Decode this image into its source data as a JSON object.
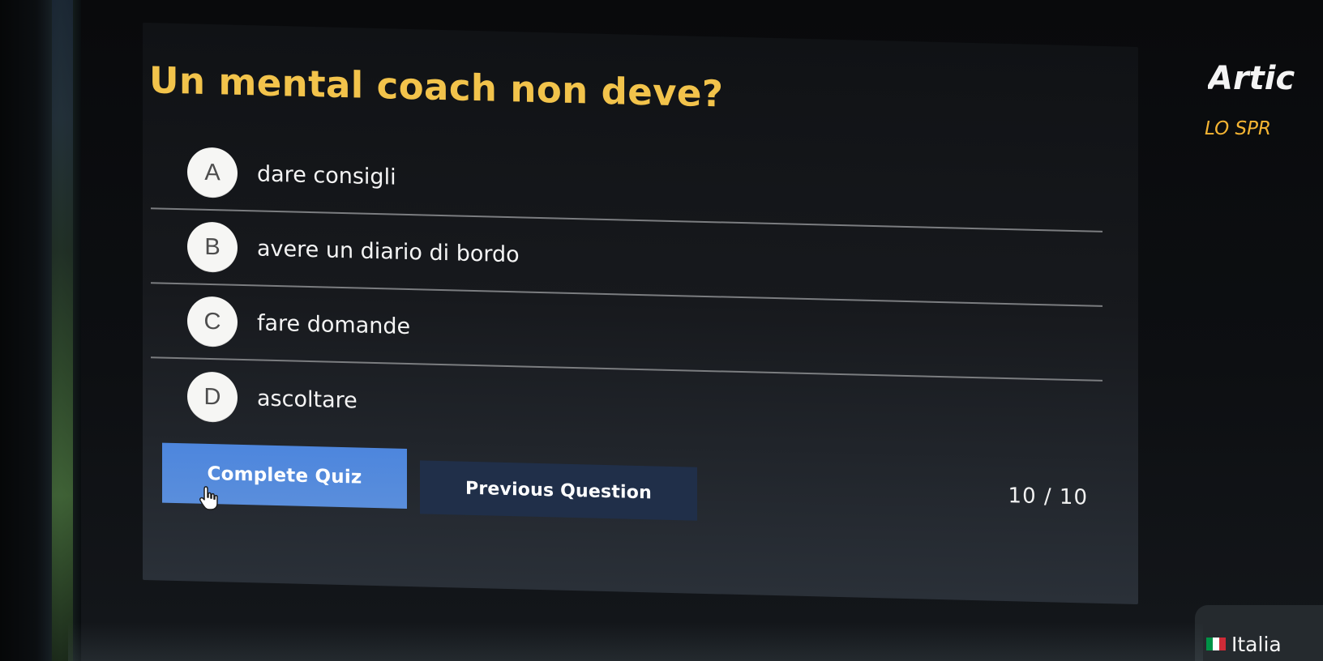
{
  "quiz": {
    "question": "Un mental coach non deve?",
    "answers": [
      {
        "letter": "A",
        "text": "dare consigli"
      },
      {
        "letter": "B",
        "text": "avere un diario di bordo"
      },
      {
        "letter": "C",
        "text": "fare domande"
      },
      {
        "letter": "D",
        "text": "ascoltare"
      }
    ],
    "buttons": {
      "complete": "Complete Quiz",
      "previous": "Previous Question"
    },
    "progress": "10 / 10"
  },
  "sidebar": {
    "heading": "Artic",
    "link": "LO SPR"
  },
  "language": {
    "label": "Italia",
    "flag_colors": [
      "#009246",
      "#ffffff",
      "#ce2b37"
    ]
  },
  "icons": {
    "cursor": "hand-pointer-icon",
    "language": "italy-flag-icon"
  },
  "colors": {
    "question": "#f2c34b",
    "primary_button": "#4d86dd",
    "secondary_button": "#202f49",
    "side_link": "#f5b533"
  }
}
